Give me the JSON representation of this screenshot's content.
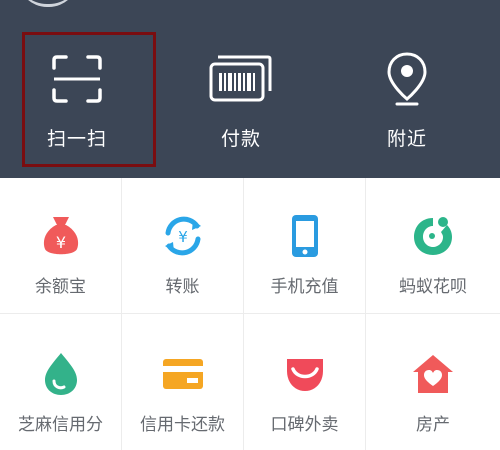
{
  "quick_actions": [
    {
      "label": "扫一扫",
      "icon": "scan-icon"
    },
    {
      "label": "付款",
      "icon": "barcode-icon"
    },
    {
      "label": "附近",
      "icon": "location-pin-icon"
    }
  ],
  "services": [
    {
      "label": "余额宝",
      "icon": "money-bag-icon",
      "color": "#f05a5a"
    },
    {
      "label": "转账",
      "icon": "transfer-icon",
      "color": "#2aa6e8"
    },
    {
      "label": "手机充值",
      "icon": "phone-icon",
      "color": "#2a9be0"
    },
    {
      "label": "蚂蚁花呗",
      "icon": "huabei-icon",
      "color": "#2cb58a"
    },
    {
      "label": "芝麻信用分",
      "icon": "sesame-credit-icon",
      "color": "#33b28a"
    },
    {
      "label": "信用卡还款",
      "icon": "credit-card-icon",
      "color": "#f5a623"
    },
    {
      "label": "口碑外卖",
      "icon": "koubei-icon",
      "color": "#f04a5a"
    },
    {
      "label": "房产",
      "icon": "house-icon",
      "color": "#f05a5a"
    }
  ],
  "colors": {
    "header_bg": "#3c4656",
    "highlight": "#7a0d10"
  }
}
